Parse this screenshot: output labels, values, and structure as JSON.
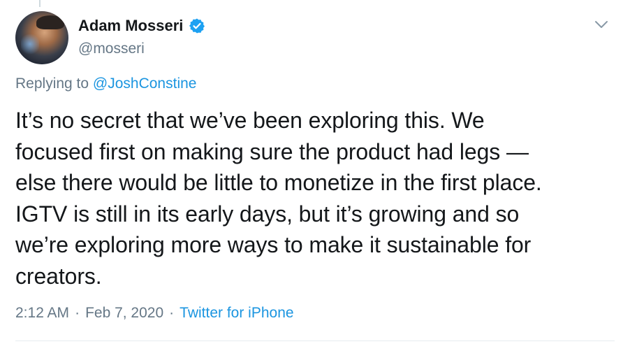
{
  "author": {
    "display_name": "Adam Mosseri",
    "handle": "@mosseri",
    "verified": true,
    "avatar_icon": "avatar-photo"
  },
  "reply": {
    "prefix": "Replying to",
    "target": "@JoshConstine"
  },
  "tweet": {
    "text_lines": [
      "It’s no secret that we’ve been exploring this. We",
      "focused first on making sure the product had legs —",
      "else there would be little to monetize in the first place.",
      "IGTV is still in its early days, but it’s growing and so",
      "we’re exploring more ways to make it sustainable for",
      "creators."
    ]
  },
  "meta": {
    "time": "2:12 AM",
    "separator": "·",
    "date": "Feb 7, 2020",
    "source": "Twitter for iPhone"
  },
  "icons": {
    "verified": "verified-badge-icon",
    "menu": "chevron-down-icon"
  },
  "colors": {
    "text": "#14171a",
    "secondary": "#657786",
    "link": "#1b95e0",
    "verified": "#1da1f2"
  }
}
